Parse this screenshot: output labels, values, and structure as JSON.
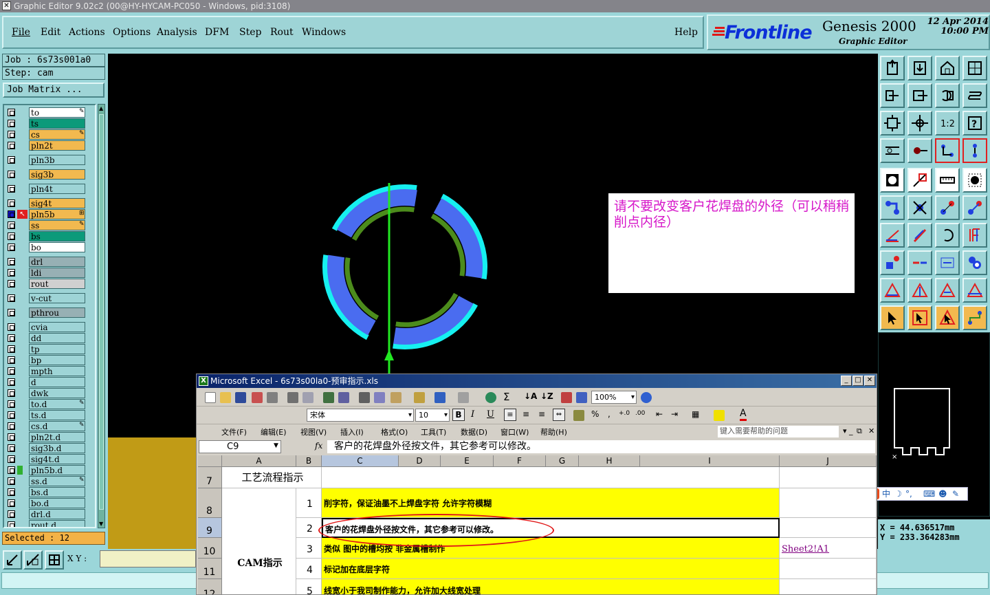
{
  "window": {
    "title": "Graphic Editor 9.02c2 (00@HY-HYCAM-PC050 - Windows, pid:3108)"
  },
  "menu": {
    "items": [
      "File",
      "Edit",
      "Actions",
      "Options",
      "Analysis",
      "DFM",
      "Step",
      "Rout",
      "Windows"
    ],
    "help": "Help"
  },
  "brand": {
    "logo": "Frontline",
    "product": "Genesis 2000",
    "subtitle": "Graphic Editor",
    "date": "12 Apr 2014",
    "time": "10:00 PM"
  },
  "job": {
    "job_label": "Job : 6s73s001a0",
    "step_label": "Step: cam",
    "matrix_button": "Job Matrix ..."
  },
  "layers": [
    {
      "name": "to",
      "color": "#ffffff",
      "flag": "✎"
    },
    {
      "name": "ts",
      "color": "#0c9a7a",
      "flag": ""
    },
    {
      "name": "cs",
      "color": "#f2b94f",
      "flag": "✎"
    },
    {
      "name": "pln2t",
      "color": "#f2b94f",
      "flag": ""
    },
    {
      "name": "pln3b",
      "color": "#9ed4d6",
      "flag": ""
    },
    {
      "name": "sig3b",
      "color": "#f2b94f",
      "flag": ""
    },
    {
      "name": "pln4t",
      "color": "#9ed4d6",
      "flag": ""
    },
    {
      "name": "sig4t",
      "color": "#f2b94f",
      "flag": ""
    },
    {
      "name": "pln5b",
      "color": "#f2b94f",
      "flag": "⊞",
      "active": true
    },
    {
      "name": "ss",
      "color": "#f2b94f",
      "flag": "✎"
    },
    {
      "name": "bs",
      "color": "#0c9a7a",
      "flag": ""
    },
    {
      "name": "bo",
      "color": "#ffffff",
      "flag": ""
    },
    {
      "name": "drl",
      "color": "#97b0b4",
      "flag": ""
    },
    {
      "name": "ldi",
      "color": "#97b0b4",
      "flag": ""
    },
    {
      "name": "rout",
      "color": "#d0d0d0",
      "flag": ""
    },
    {
      "name": "v-cut",
      "color": "#9ed4d6",
      "flag": ""
    },
    {
      "name": "pthrou",
      "color": "#97b0b4",
      "flag": ""
    },
    {
      "name": "cvia",
      "color": "#9ed4d6",
      "flag": ""
    },
    {
      "name": "dd",
      "color": "#9ed4d6",
      "flag": ""
    },
    {
      "name": "tp",
      "color": "#9ed4d6",
      "flag": ""
    },
    {
      "name": "bp",
      "color": "#9ed4d6",
      "flag": ""
    },
    {
      "name": "mpth",
      "color": "#9ed4d6",
      "flag": ""
    },
    {
      "name": "d",
      "color": "#9ed4d6",
      "flag": ""
    },
    {
      "name": "dwk",
      "color": "#9ed4d6",
      "flag": ""
    },
    {
      "name": "to.d",
      "color": "#9ed4d6",
      "flag": "✎"
    },
    {
      "name": "ts.d",
      "color": "#9ed4d6",
      "flag": ""
    },
    {
      "name": "cs.d",
      "color": "#9ed4d6",
      "flag": "✎"
    },
    {
      "name": "pln2t.d",
      "color": "#9ed4d6",
      "flag": ""
    },
    {
      "name": "sig3b.d",
      "color": "#9ed4d6",
      "flag": ""
    },
    {
      "name": "sig4t.d",
      "color": "#9ed4d6",
      "flag": ""
    },
    {
      "name": "pln5b.d",
      "color": "#9ed4d6",
      "flag": ""
    },
    {
      "name": "ss.d",
      "color": "#9ed4d6",
      "flag": "✎"
    },
    {
      "name": "bs.d",
      "color": "#9ed4d6",
      "flag": ""
    },
    {
      "name": "bo.d",
      "color": "#9ed4d6",
      "flag": ""
    },
    {
      "name": "drl.d",
      "color": "#9ed4d6",
      "flag": ""
    },
    {
      "name": "rout.d",
      "color": "#9ed4d6",
      "flag": ""
    }
  ],
  "selected": "Selected : 12",
  "annotation_note": "请不要改变客户花焊盘的外径（可以稍稍削点内径）",
  "coords": {
    "x": "X  =  44.636517mm",
    "y": "Y  = 233.364283mm"
  },
  "units": "MM",
  "xy_label": "X Y :",
  "excel": {
    "title": "Microsoft Excel - 6s73s00la0-预审指示.xls",
    "font_name": "宋体",
    "font_size": "10",
    "zoom": "100%",
    "menu": [
      "文件(F)",
      "编辑(E)",
      "视图(V)",
      "插入(I)",
      "格式(O)",
      "工具(T)",
      "数据(D)",
      "窗口(W)",
      "帮助(H)"
    ],
    "help_placeholder": "键入需要帮助的问题",
    "name_box": "C9",
    "fx": "fx",
    "formula": "客户的花焊盘外径按文件，其它参考可以修改。",
    "columns": [
      "A",
      "B",
      "C",
      "D",
      "E",
      "F",
      "G",
      "H",
      "I",
      "J"
    ],
    "rows": [
      {
        "num": "7",
        "a": "工艺流程指示",
        "b": "",
        "c": "",
        "j": ""
      },
      {
        "num": "8",
        "a": "",
        "b": "1",
        "c": "削字符，保证油墨不上焊盘字符  允许字符模糊",
        "j": ""
      },
      {
        "num": "9",
        "a": "",
        "b": "2",
        "c": "客户的花焊盘外径按文件，其它参考可以修改。",
        "j": ""
      },
      {
        "num": "10",
        "a": "",
        "b": "3",
        "c": "类似  图中的槽均按  非金属槽制作",
        "j": "Sheet2!A1"
      },
      {
        "num": "11",
        "a": "CAM指示",
        "b": "4",
        "c": "标记加在底层字符",
        "j": ""
      },
      {
        "num": "12",
        "a": "",
        "b": "5",
        "c": "线宽小于我司制作能力，允许加大线宽处理",
        "j": ""
      }
    ]
  },
  "colors": {
    "panel": "#9bd6d9",
    "pad_blue": "#4a6cf0",
    "pad_cyan": "#16f0f0",
    "pad_green": "#4c8c1c",
    "yellow_cell": "#ffff00"
  }
}
